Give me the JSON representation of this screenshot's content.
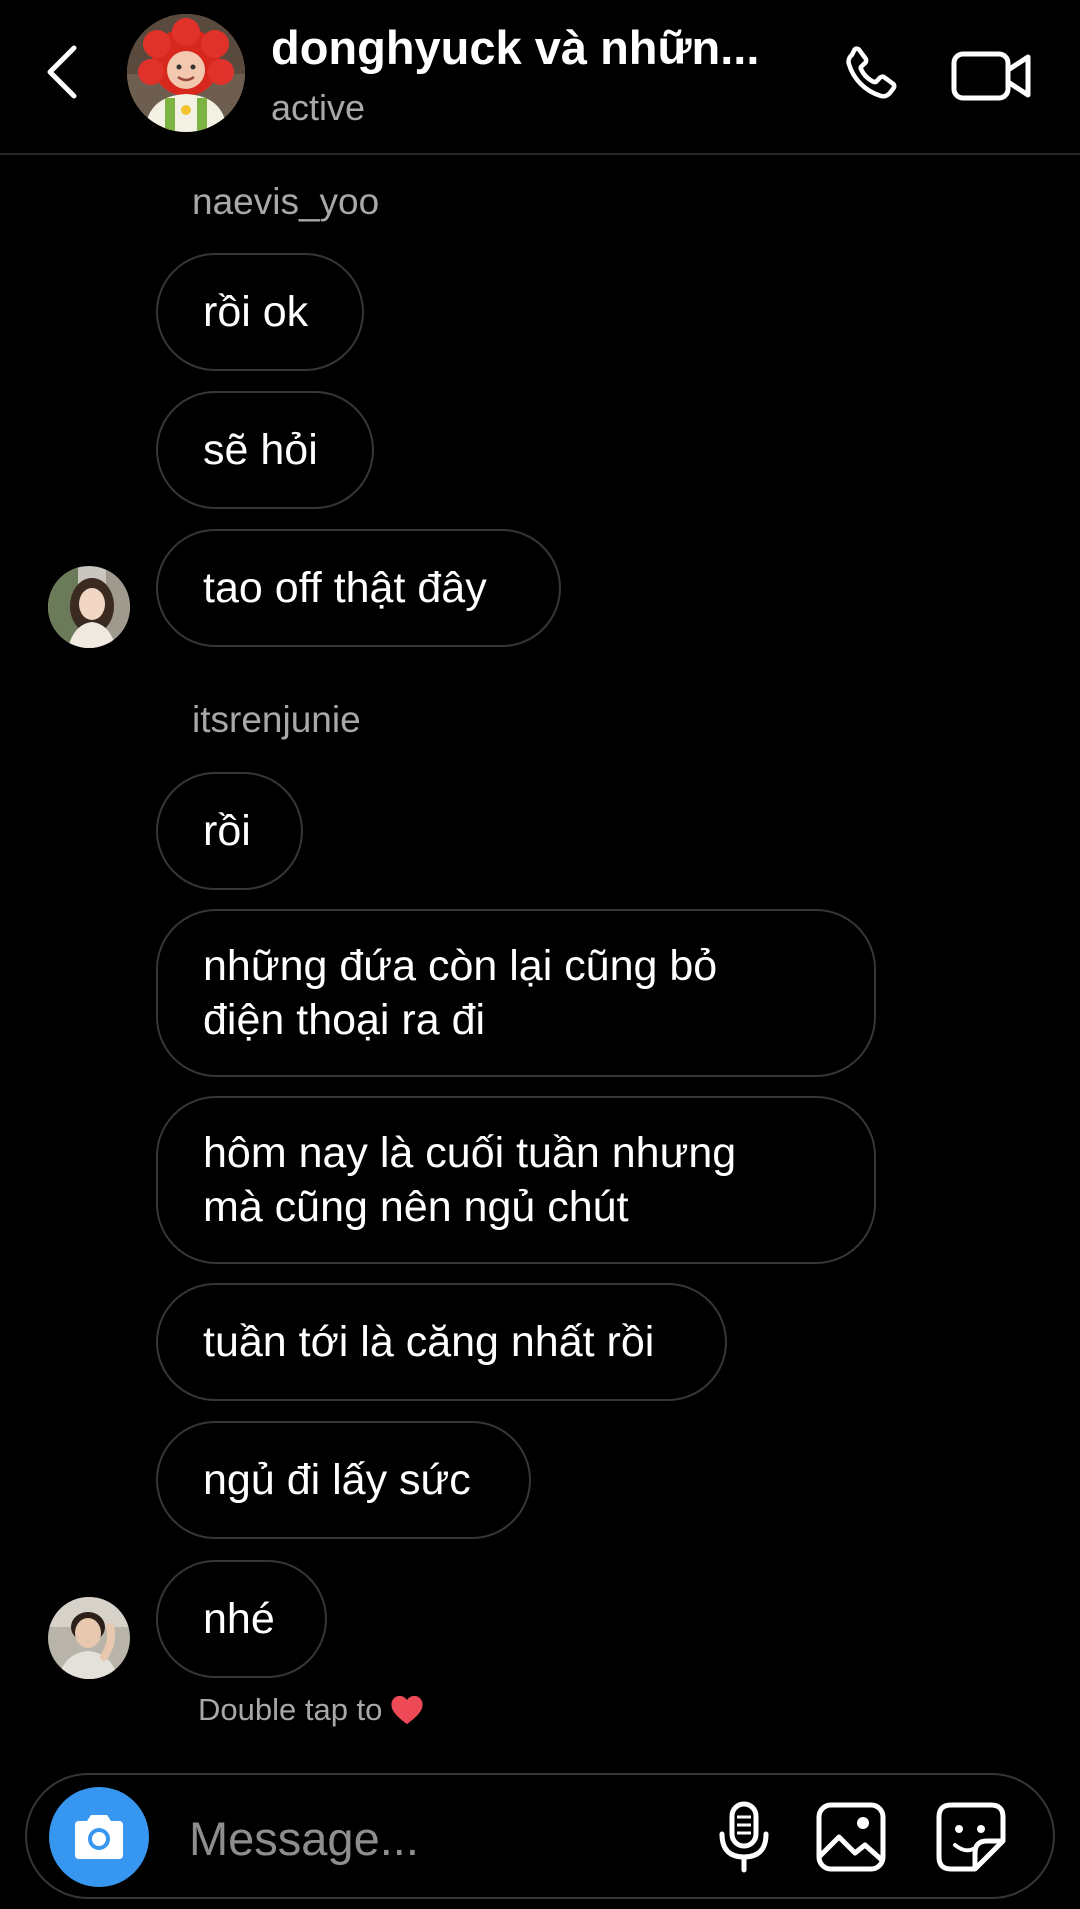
{
  "colors": {
    "background": "#000000",
    "bubble_border": "#363636",
    "secondary_text": "#a8a8a8",
    "camera_button": "#3797f0",
    "heart": "#ed4956"
  },
  "header": {
    "back_icon": "chevron-left-icon",
    "title": "donghyuck và nhữn...",
    "subtitle": "active",
    "call_icon": "phone-icon",
    "video_icon": "video-camera-icon"
  },
  "messages": [
    {
      "sender": "naevis_yoo",
      "bubbles": [
        "rồi ok",
        "sẽ hỏi",
        "tao off thật đây"
      ]
    },
    {
      "sender": "itsrenjunie",
      "bubbles": [
        "rồi",
        "những đứa còn lại cũng bỏ điện thoại ra đi",
        "hôm nay là cuối tuần nhưng mà cũng nên ngủ chút",
        "tuần tới là căng nhất rồi",
        "ngủ đi lấy sức",
        "nhé"
      ]
    }
  ],
  "hint": {
    "text": "Double tap to",
    "icon": "heart-icon"
  },
  "composer": {
    "camera_icon": "camera-icon",
    "placeholder": "Message...",
    "mic_icon": "microphone-icon",
    "gallery_icon": "image-icon",
    "sticker_icon": "sticker-icon"
  }
}
